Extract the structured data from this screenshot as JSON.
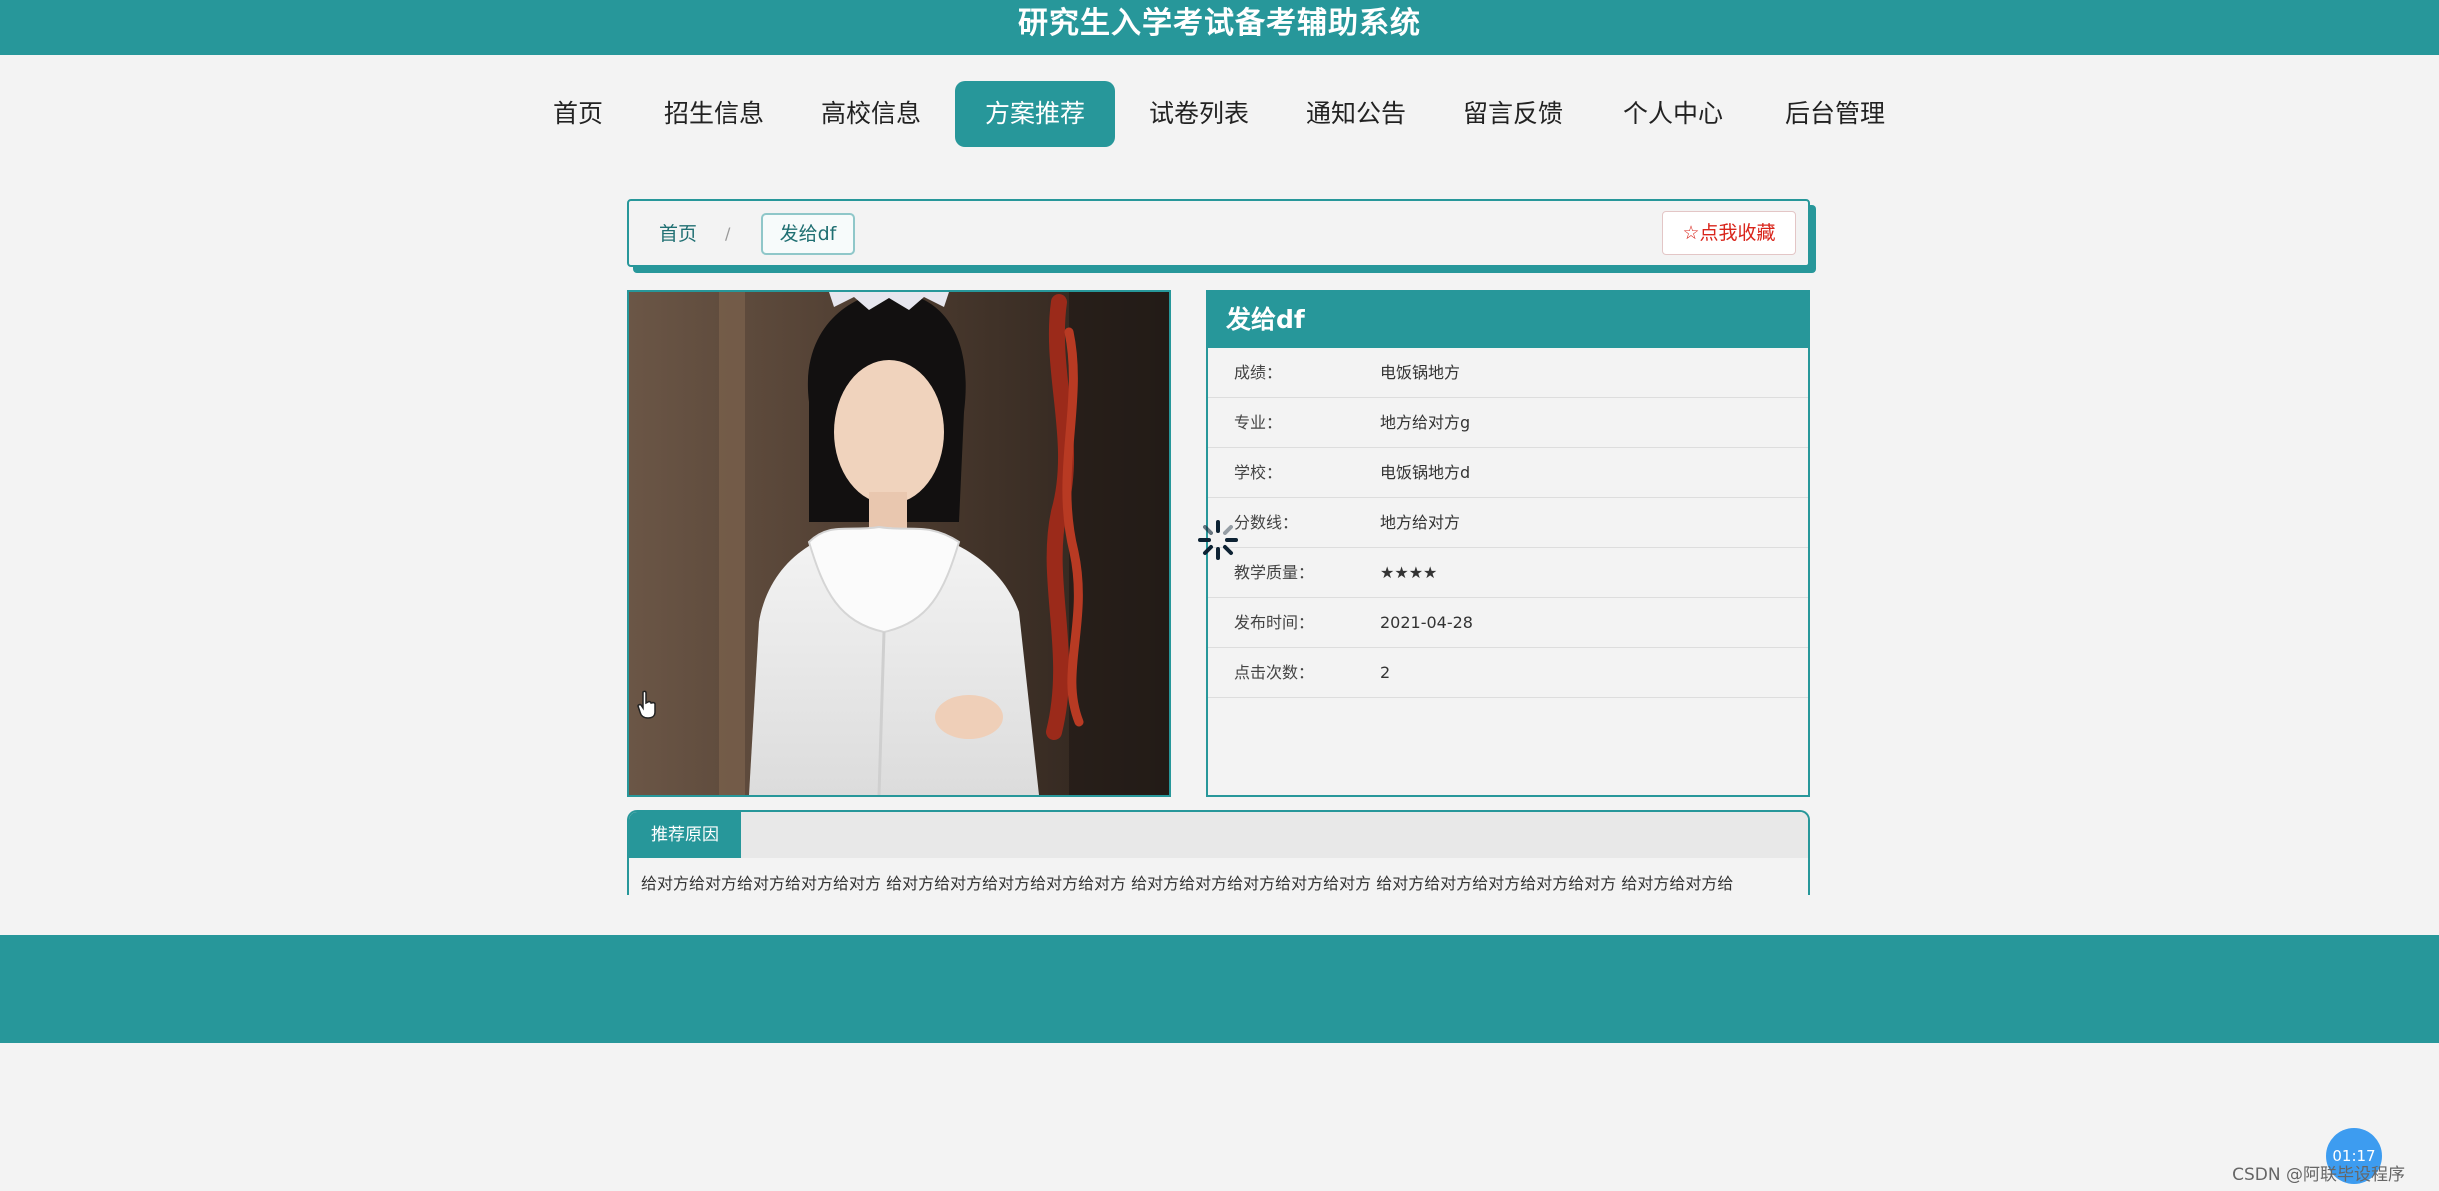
{
  "header": {
    "title": "研究生入学考试备考辅助系统"
  },
  "nav": {
    "items": [
      {
        "label": "首页"
      },
      {
        "label": "招生信息"
      },
      {
        "label": "高校信息"
      },
      {
        "label": "方案推荐",
        "active": true
      },
      {
        "label": "试卷列表"
      },
      {
        "label": "通知公告"
      },
      {
        "label": "留言反馈"
      },
      {
        "label": "个人中心"
      },
      {
        "label": "后台管理"
      }
    ]
  },
  "breadcrumb": {
    "home": "首页",
    "separator": "/",
    "current": "发给df"
  },
  "favorite": {
    "label": "☆点我收藏"
  },
  "detail": {
    "title": "发给df",
    "fields": [
      {
        "label": "成绩：",
        "value": "电饭锅地方"
      },
      {
        "label": "专业：",
        "value": "地方给对方g"
      },
      {
        "label": "学校：",
        "value": "电饭锅地方d"
      },
      {
        "label": "分数线：",
        "value": "地方给对方"
      },
      {
        "label": "教学质量：",
        "value": "★★★★"
      },
      {
        "label": "发布时间：",
        "value": "2021-04-28"
      },
      {
        "label": "点击次数：",
        "value": "2"
      }
    ]
  },
  "reason": {
    "tab_label": "推荐原因",
    "text": "给对方给对方给对方给对方给对方 给对方给对方给对方给对方给对方 给对方给对方给对方给对方给对方 给对方给对方给对方给对方给对方 给对方给对方给"
  },
  "overlay": {
    "timer": "01:17",
    "watermark": "CSDN @阿联毕设程序"
  },
  "colors": {
    "accent": "#27979a",
    "favorite": "#d9251b",
    "page_bg": "#f3f3f3"
  }
}
